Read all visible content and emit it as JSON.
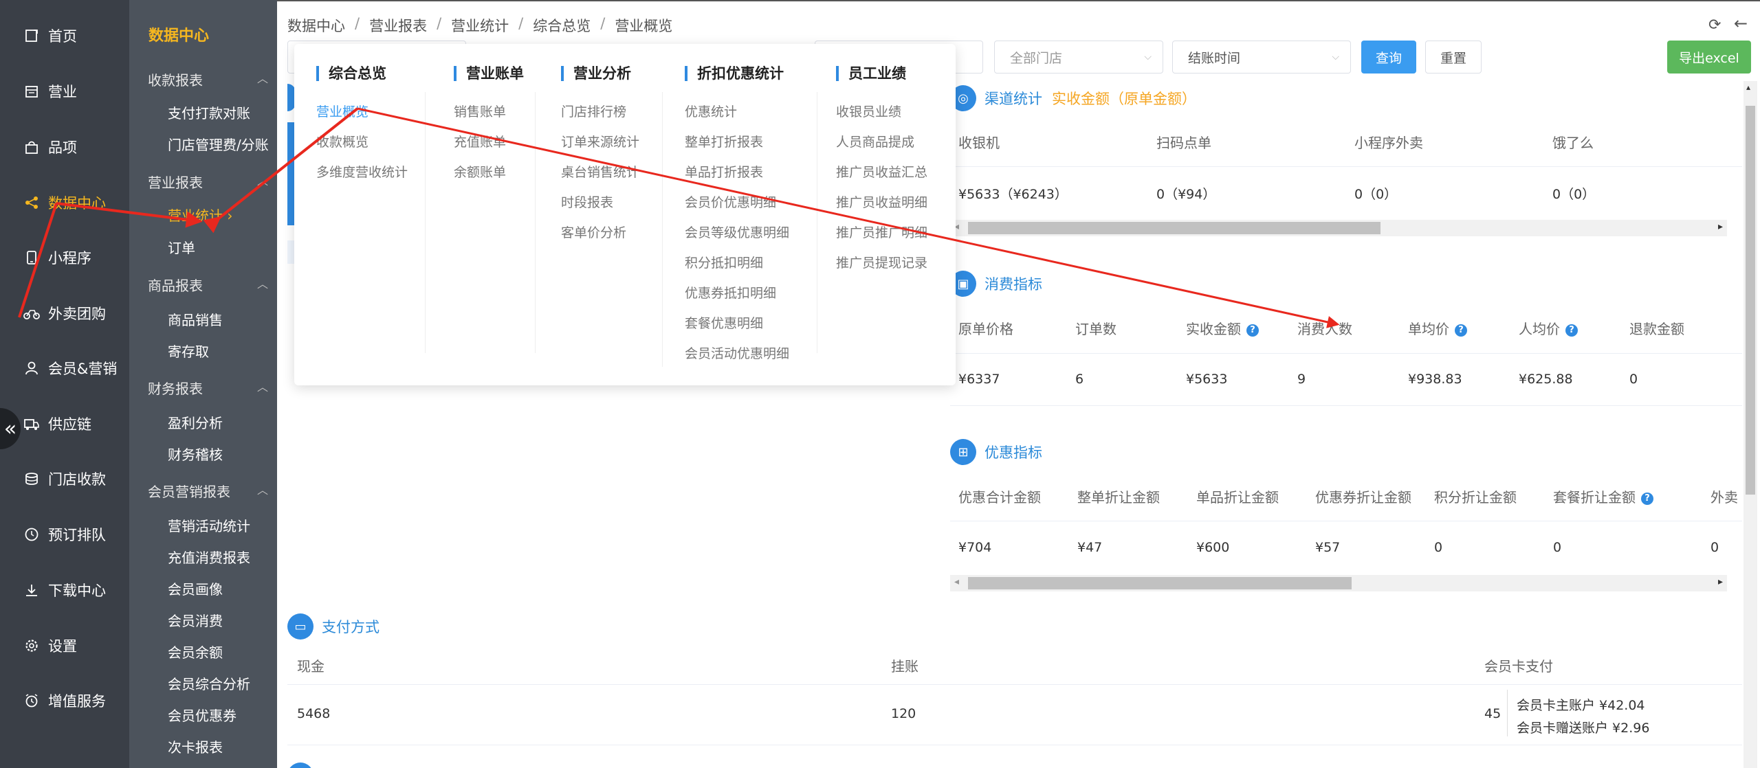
{
  "nav1": {
    "items": [
      {
        "label": "首页",
        "icon": "home-icon"
      },
      {
        "label": "营业",
        "icon": "calendar-icon"
      },
      {
        "label": "品项",
        "icon": "bag-icon"
      },
      {
        "label": "数据中心",
        "icon": "share-icon"
      },
      {
        "label": "小程序",
        "icon": "phone-icon"
      },
      {
        "label": "外卖团购",
        "icon": "bike-icon"
      },
      {
        "label": "会员&营销",
        "icon": "user-icon"
      },
      {
        "label": "供应链",
        "icon": "truck-icon"
      },
      {
        "label": "门店收款",
        "icon": "coins-icon"
      },
      {
        "label": "预订排队",
        "icon": "clock-icon"
      },
      {
        "label": "下载中心",
        "icon": "download-icon"
      },
      {
        "label": "设置",
        "icon": "gear-icon"
      },
      {
        "label": "增值服务",
        "icon": "alarm-icon"
      }
    ],
    "active_index": 3,
    "active_color": "#f6b71f"
  },
  "nav2": {
    "title": "数据中心",
    "groups": [
      {
        "label": "收款报表",
        "items": [
          "支付打款对账",
          "门店管理费/分账"
        ]
      },
      {
        "label": "营业报表",
        "items": [
          "营业统计",
          "订单"
        ]
      },
      {
        "label": "商品报表",
        "items": [
          "商品销售",
          "寄存取"
        ]
      },
      {
        "label": "财务报表",
        "items": [
          "盈利分析",
          "财务稽核"
        ]
      },
      {
        "label": "会员营销报表",
        "items": [
          "营销活动统计",
          "充值消费报表",
          "会员画像",
          "会员消费",
          "会员余额",
          "会员综合分析",
          "会员优惠券",
          "次卡报表"
        ]
      }
    ],
    "active_item": "营业统计"
  },
  "breadcrumb": [
    "数据中心",
    "营业报表",
    "营业统计",
    "综合总览",
    "营业概览"
  ],
  "filters": {
    "store_placeholder": "全部门店",
    "time_value": "结账时间",
    "query_label": "查询",
    "reset_label": "重置",
    "export_label": "导出excel"
  },
  "channel": {
    "title": "渠道统计",
    "subtitle": "实收金额（原单金额）",
    "headers": [
      "收银机",
      "扫码点单",
      "小程序外卖",
      "饿了么"
    ],
    "values": [
      "¥5633（¥6243）",
      "0（¥94）",
      "0（0）",
      "0（0）"
    ]
  },
  "consume": {
    "title": "消费指标",
    "headers": [
      "原单价格",
      "订单数",
      "实收金额",
      "消费人数",
      "单均价",
      "人均价",
      "退款金额"
    ],
    "help": [
      false,
      false,
      true,
      false,
      true,
      true,
      false
    ],
    "values": [
      "¥6337",
      "6",
      "¥5633",
      "9",
      "¥938.83",
      "¥625.88",
      "0"
    ]
  },
  "discount": {
    "title": "优惠指标",
    "headers": [
      "优惠合计金额",
      "整单折让金额",
      "单品折让金额",
      "优惠券折让金额",
      "积分折让金额",
      "套餐折让金额",
      "外卖"
    ],
    "help": [
      false,
      false,
      false,
      false,
      false,
      true,
      false
    ],
    "values": [
      "¥704",
      "¥47",
      "¥600",
      "¥57",
      "0",
      "0",
      "0"
    ]
  },
  "payment": {
    "title": "支付方式",
    "headers": [
      "现金",
      "挂账",
      "会员卡支付"
    ],
    "values": [
      "5468",
      "120",
      "45"
    ],
    "member_detail": [
      "会员卡主账户 ¥42.04",
      "会员卡赠送账户 ¥2.96"
    ]
  },
  "mega_menu": {
    "columns": [
      {
        "title": "综合总览",
        "items": [
          "营业概览",
          "收款概览",
          "多维度营收统计"
        ]
      },
      {
        "title": "营业账单",
        "items": [
          "销售账单",
          "充值账单",
          "余额账单"
        ]
      },
      {
        "title": "营业分析",
        "items": [
          "门店排行榜",
          "订单来源统计",
          "桌台销售统计",
          "时段报表",
          "客单价分析"
        ]
      },
      {
        "title": "折扣优惠统计",
        "items": [
          "优惠统计",
          "整单打折报表",
          "单品打折报表",
          "会员价优惠明细",
          "会员等级优惠明细",
          "积分抵扣明细",
          "优惠券抵扣明细",
          "套餐优惠明细",
          "会员活动优惠明细"
        ]
      },
      {
        "title": "员工业绩",
        "items": [
          "收银员业绩",
          "人员商品提成",
          "推广员收益汇总",
          "推广员收益明细",
          "推广员推广明细",
          "推广员提现记录"
        ]
      }
    ],
    "active_item": "营业概览",
    "accent": "#3a9cf0"
  },
  "annotation_color": "#e8281e"
}
